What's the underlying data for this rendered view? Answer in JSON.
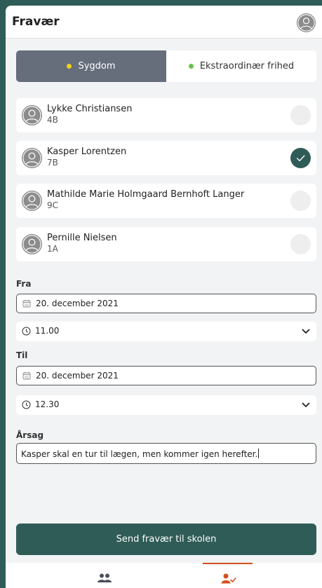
{
  "header": {
    "title": "Fravær"
  },
  "type_selector": {
    "options": [
      {
        "label": "Sygdom",
        "dot_color": "#f2d11d",
        "selected": true
      },
      {
        "label": "Ekstraordinær frihed",
        "dot_color": "#6cc04a",
        "selected": false
      }
    ]
  },
  "students": [
    {
      "name": "Lykke Christiansen",
      "class": "4B",
      "checked": false
    },
    {
      "name": "Kasper Lorentzen",
      "class": "7B",
      "checked": true
    },
    {
      "name": "Mathilde Marie Holmgaard Bernhoft Langer",
      "class": "9C",
      "checked": false
    },
    {
      "name": "Pernille Nielsen",
      "class": "1A",
      "checked": false
    }
  ],
  "from": {
    "label": "Fra",
    "date": "20. december 2021",
    "time": "11.00"
  },
  "to": {
    "label": "Til",
    "date": "20. december 2021",
    "time": "12.30"
  },
  "reason": {
    "label": "Årsag",
    "value": "Kasper skal en tur til lægen, men kommer igen herefter."
  },
  "send_button": {
    "label": "Send fravær til skolen"
  },
  "tabbar": {
    "tabs": [
      {
        "icon": "users-icon",
        "active": false
      },
      {
        "icon": "user-check-icon",
        "active": true
      }
    ]
  },
  "colors": {
    "primary": "#2f5c57",
    "accent": "#d4501c",
    "segment_active": "#666d7b",
    "background": "#f2f3f4"
  }
}
